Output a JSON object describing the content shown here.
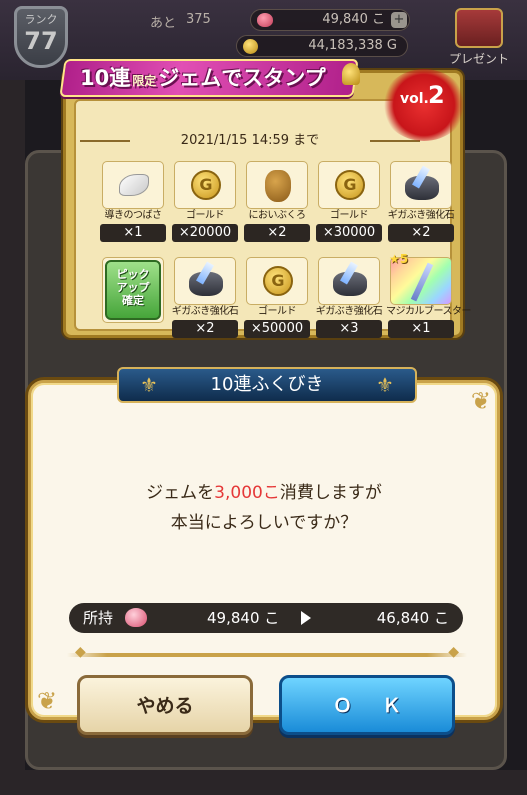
{
  "header": {
    "rank_label": "ランク",
    "rank_value": "77",
    "ato_label": "あと",
    "ato_value": "375",
    "gems": "49,840 こ",
    "gold": "44,183,338 G",
    "present_label": "プレゼント"
  },
  "stamp": {
    "banner_num": "10連",
    "banner_limited": "限定",
    "banner_text": "ジェムでスタンプ",
    "vol_prefix": "vol.",
    "vol_num": "2",
    "deadline": "2021/1/15 14:59 まで",
    "rewards": [
      {
        "name": "導きのつばさ",
        "qty": "×1",
        "icon": "wing-icon"
      },
      {
        "name": "ゴールド",
        "qty": "×20000",
        "icon": "gold-coin-icon"
      },
      {
        "name": "においぶくろ",
        "qty": "×2",
        "icon": "scent-bag-icon"
      },
      {
        "name": "ゴールド",
        "qty": "×30000",
        "icon": "gold-coin-icon"
      },
      {
        "name": "ギガぶき強化石",
        "qty": "×2",
        "icon": "giga-stone-icon"
      },
      {
        "name": "ピックアップ確定",
        "qty": "",
        "icon": "pickup-icon"
      },
      {
        "name": "ギガぶき強化石",
        "qty": "×2",
        "icon": "giga-stone-icon"
      },
      {
        "name": "ゴールド",
        "qty": "×50000",
        "icon": "gold-coin-icon"
      },
      {
        "name": "ギガぶき強化石",
        "qty": "×3",
        "icon": "giga-stone-icon"
      },
      {
        "name": "マジカルブースター",
        "qty": "×1",
        "icon": "magical-booster-icon",
        "stars": "★5"
      }
    ],
    "pickup_line1": "ピック",
    "pickup_line2": "アップ",
    "pickup_line3": "確定"
  },
  "dialog": {
    "title": "10連ふくびき",
    "message_pre": "ジェムを",
    "message_amount": "3,000こ",
    "message_post": "消費しますが",
    "message_line2": "本当によろしいですか？",
    "own_label": "所持",
    "own_from": "49,840 こ",
    "own_to": "46,840 こ",
    "cancel_label": "やめる",
    "ok_label": "ＯＫ"
  },
  "colors": {
    "accent_red": "#e53838",
    "ok_blue": "#1a8cd8",
    "gold_border": "#c9a24a"
  }
}
